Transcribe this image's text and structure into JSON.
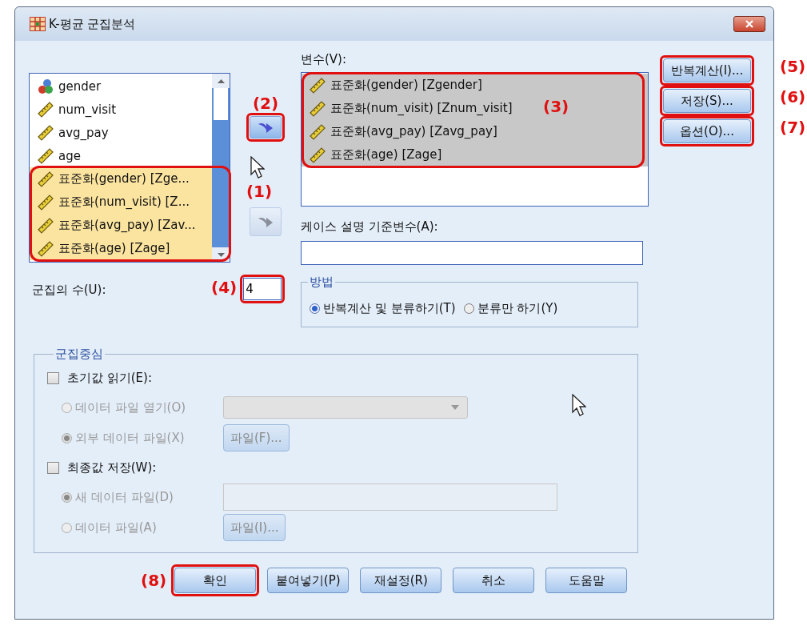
{
  "window": {
    "title": "K-평균 군집분석"
  },
  "source_list": {
    "marker": "(1)",
    "items": [
      {
        "label": "gender",
        "kind": "nominal",
        "selected": false
      },
      {
        "label": "num_visit",
        "kind": "scale",
        "selected": false
      },
      {
        "label": "avg_pay",
        "kind": "scale",
        "selected": false
      },
      {
        "label": "age",
        "kind": "scale",
        "selected": false
      },
      {
        "label": "표준화(gender) [Zge...",
        "kind": "scale",
        "selected": true
      },
      {
        "label": "표준화(num_visit) [Z...",
        "kind": "scale",
        "selected": true
      },
      {
        "label": "표준화(avg_pay) [Zav...",
        "kind": "scale",
        "selected": true
      },
      {
        "label": "표준화(age) [Zage]",
        "kind": "scale",
        "selected": true
      }
    ]
  },
  "move_buttons": [
    {
      "marker": "(2)",
      "disabled": false
    },
    {
      "disabled": true
    }
  ],
  "variables": {
    "label": "변수(V):",
    "marker": "(3)",
    "items": [
      {
        "label": "표준화(gender) [Zgender]",
        "kind": "scale",
        "selected": true
      },
      {
        "label": "표준화(num_visit) [Znum_visit]",
        "kind": "scale",
        "selected": true
      },
      {
        "label": "표준화(avg_pay) [Zavg_pay]",
        "kind": "scale",
        "selected": true
      },
      {
        "label": "표준화(age) [Zage]",
        "kind": "scale",
        "selected": true
      }
    ]
  },
  "case_label": {
    "label": "케이스 설명 기준변수(A):"
  },
  "side_buttons": [
    {
      "label": "반복계산(I)...",
      "marker": "(5)"
    },
    {
      "label": "저장(S)...",
      "marker": "(6)"
    },
    {
      "label": "옵션(O)...",
      "marker": "(7)"
    }
  ],
  "clusters": {
    "label": "군집의 수(U):",
    "marker": "(4)",
    "value": "4"
  },
  "method": {
    "title": "방법",
    "options": [
      {
        "label": "반복계산 및 분류하기(T)",
        "selected": true
      },
      {
        "label": "분류만 하기(Y)",
        "selected": false
      }
    ]
  },
  "centers": {
    "title": "군집중심",
    "groups": [
      {
        "label": "초기값 읽기(E):",
        "checked": false,
        "options": [
          {
            "label": "데이터 파일 열기(O)",
            "selected": false,
            "disabled": true,
            "control": {
              "kind": "dropdown"
            }
          },
          {
            "label": "외부 데이터 파일(X)",
            "selected": true,
            "disabled": true,
            "control": {
              "kind": "button",
              "label": "파일(F)..."
            }
          }
        ]
      },
      {
        "label": "최종값 저장(W):",
        "checked": false,
        "options": [
          {
            "label": "새 데이터 파일(D)",
            "selected": true,
            "disabled": true,
            "control": {
              "kind": "field"
            }
          },
          {
            "label": "데이터 파일(A)",
            "selected": false,
            "disabled": true,
            "control": {
              "kind": "button",
              "label": "파일(I)..."
            }
          }
        ]
      }
    ]
  },
  "footer_buttons": [
    {
      "label": "확인",
      "marker": "(8)"
    },
    {
      "label": "붙여넣기(P)"
    },
    {
      "label": "재설정(R)"
    },
    {
      "label": "취소"
    },
    {
      "label": "도움말"
    }
  ]
}
